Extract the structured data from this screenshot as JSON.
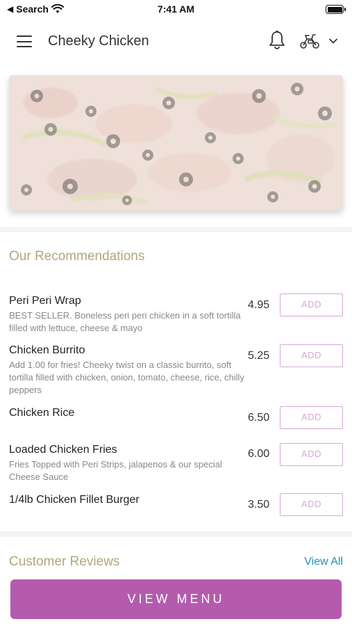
{
  "status_bar": {
    "back_label": "Search",
    "time": "7:41 AM"
  },
  "header": {
    "title": "Cheeky Chicken"
  },
  "icons": {
    "menu": "hamburger-menu-icon",
    "notifications": "bell-icon",
    "delivery": "scooter-icon",
    "dropdown": "chevron-down-icon"
  },
  "recommendations": {
    "title": "Our Recommendations",
    "add_label": "ADD",
    "items": [
      {
        "name": "Peri Peri Wrap",
        "description": "BEST SELLER. Boneless peri peri chicken in a soft tortilla filled with lettuce, cheese & mayo",
        "price": "4.95"
      },
      {
        "name": "Chicken Burrito",
        "description": "Add 1.00 for fries! Cheeky twist on a classic burrito, soft tortilla filled with chicken, onion, tomato, cheese, rice, chilly peppers",
        "price": "5.25"
      },
      {
        "name": "Chicken Rice",
        "description": "",
        "price": "6.50"
      },
      {
        "name": "Loaded Chicken Fries",
        "description": "Fries Topped with Peri Strips, jalapenos & our special Cheese Sauce",
        "price": "6.00"
      },
      {
        "name": "1/4lb Chicken Fillet Burger",
        "description": "",
        "price": "3.50"
      }
    ]
  },
  "reviews": {
    "title": "Customer Reviews",
    "view_all_label": "View All"
  },
  "footer": {
    "view_menu_label": "VIEW MENU"
  },
  "colors": {
    "accent": "#b45bae",
    "section_title": "#b3a57c",
    "link": "#1d8fc0",
    "add_border": "#d9a6d6"
  }
}
